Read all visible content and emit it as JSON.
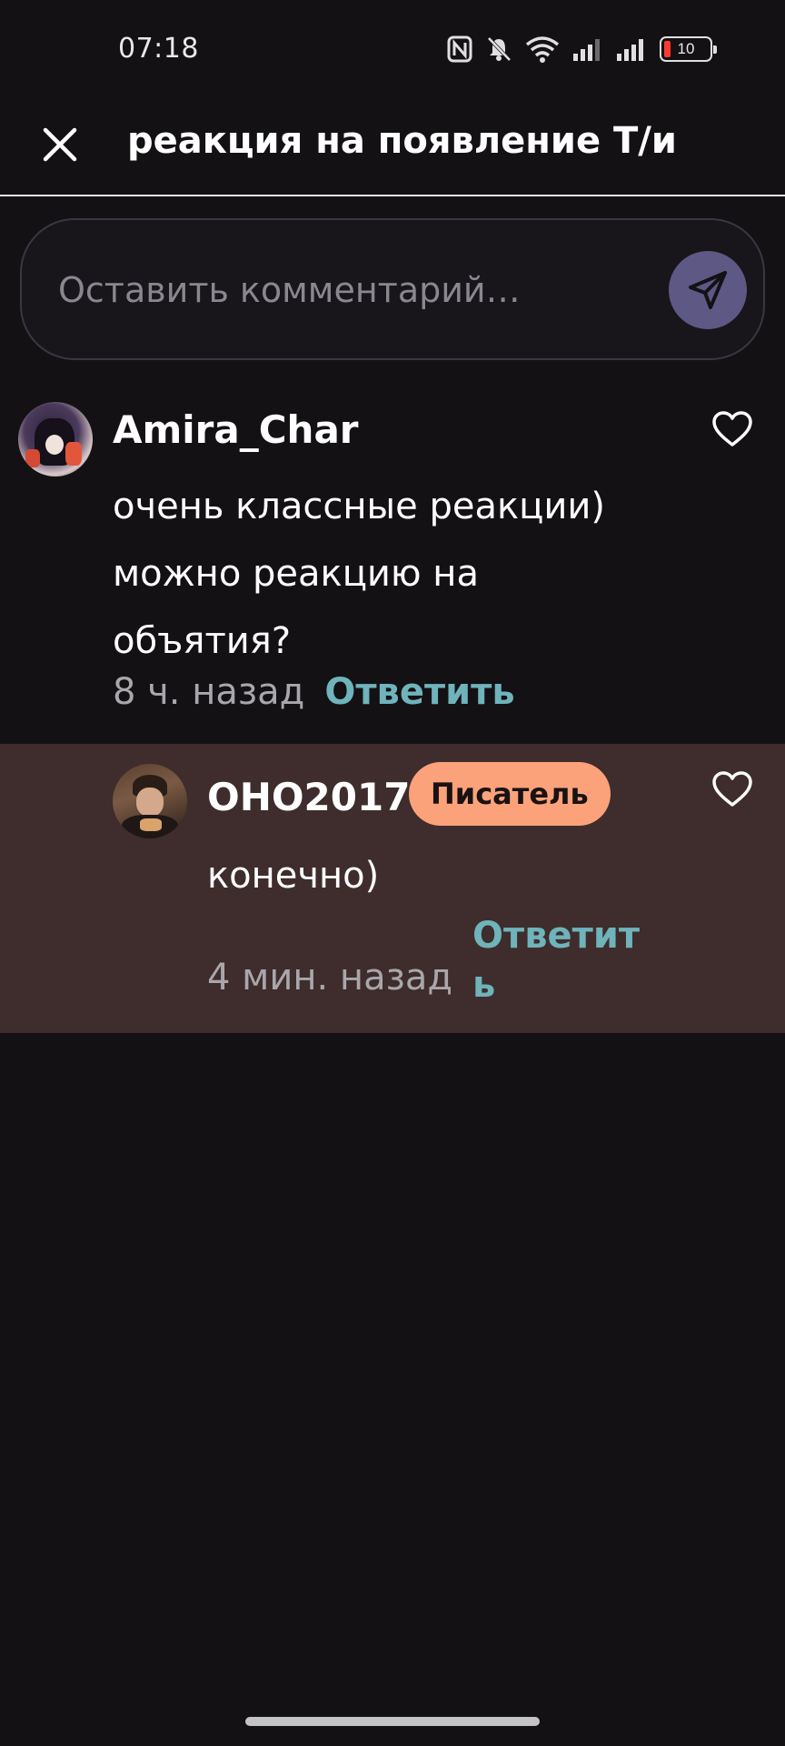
{
  "status_bar": {
    "time": "07:18",
    "battery": "10",
    "icons": [
      "nfc-icon",
      "bell-muted-icon",
      "wifi-icon",
      "signal-icon",
      "signal-icon",
      "battery-icon"
    ]
  },
  "header": {
    "title": "реакция на появление Т/и",
    "close_icon": "close-icon"
  },
  "comment_input": {
    "placeholder": "Оставить комментарий…",
    "value": "",
    "send_icon": "send-icon"
  },
  "comments": [
    {
      "username": "Amira_Char",
      "text": "очень классные реакции) можно реакцию на объятия?",
      "time": "8 ч. назад",
      "reply_label": "Ответить",
      "like_icon": "heart-icon"
    }
  ],
  "replies": [
    {
      "username": "OHO2017",
      "badge": "Писатель",
      "text": "конечно)",
      "time": "4 мин. назад",
      "reply_label": "Ответить",
      "like_icon": "heart-icon"
    }
  ],
  "colors": {
    "background": "#131114",
    "accent_link": "#6fb3bb",
    "badge": "#fca27a",
    "highlight": "#3e2d2c",
    "send_button": "#5e5885"
  }
}
